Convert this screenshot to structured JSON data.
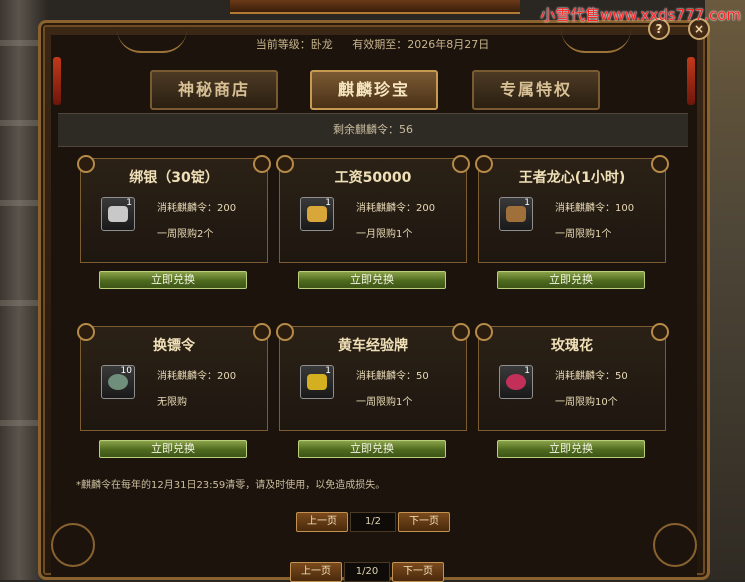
{
  "watermark": "小雪代售www.xxds777.com",
  "header": {
    "level": "当前等级：卧龙",
    "valid_until": "有效期至：2026年8月27日"
  },
  "controls": {
    "help": "?",
    "close": "×"
  },
  "tabs": [
    {
      "label": "神秘商店",
      "active": false
    },
    {
      "label": "麒麟珍宝",
      "active": true
    },
    {
      "label": "专属特权",
      "active": false
    }
  ],
  "remaining": "剩余麒麟令：56",
  "items": [
    {
      "name": "绑银（30锭）",
      "cost": "消耗麒麟令：200",
      "limit": "一周限购2个",
      "qty": "1",
      "icon": "silver-ingot-icon",
      "color": "#c8c8c8",
      "button": "立即兑换"
    },
    {
      "name": "工资50000",
      "cost": "消耗麒麟令：200",
      "limit": "一月限购1个",
      "qty": "1",
      "icon": "gold-coins-icon",
      "color": "#d9a63a",
      "button": "立即兑换"
    },
    {
      "name": "王者龙心(1小时)",
      "cost": "消耗麒麟令：100",
      "limit": "一周限购1个",
      "qty": "1",
      "icon": "dragon-heart-icon",
      "color": "#a0703a",
      "button": "立即兑换"
    },
    {
      "name": "换镖令",
      "cost": "消耗麒麟令：200",
      "limit": "无限购",
      "qty": "10",
      "icon": "escort-token-icon",
      "color": "#6f8f7a",
      "button": "立即兑换"
    },
    {
      "name": "黄车经验牌",
      "cost": "消耗麒麟令：50",
      "limit": "一周限购1个",
      "qty": "1",
      "icon": "yellow-cart-icon",
      "color": "#d4b020",
      "button": "立即兑换"
    },
    {
      "name": "玫瑰花",
      "cost": "消耗麒麟令：50",
      "limit": "一周限购10个",
      "qty": "1",
      "icon": "rose-icon",
      "color": "#c2305a",
      "button": "立即兑换"
    }
  ],
  "note": "*麒麟令在每年的12月31日23:59清零，请及时使用，以免造成损失。",
  "pager": {
    "prev": "上一页",
    "page": "1/2",
    "next": "下一页"
  },
  "outer_pager": {
    "prev": "上一页",
    "page": "1/20",
    "next": "下一页"
  }
}
